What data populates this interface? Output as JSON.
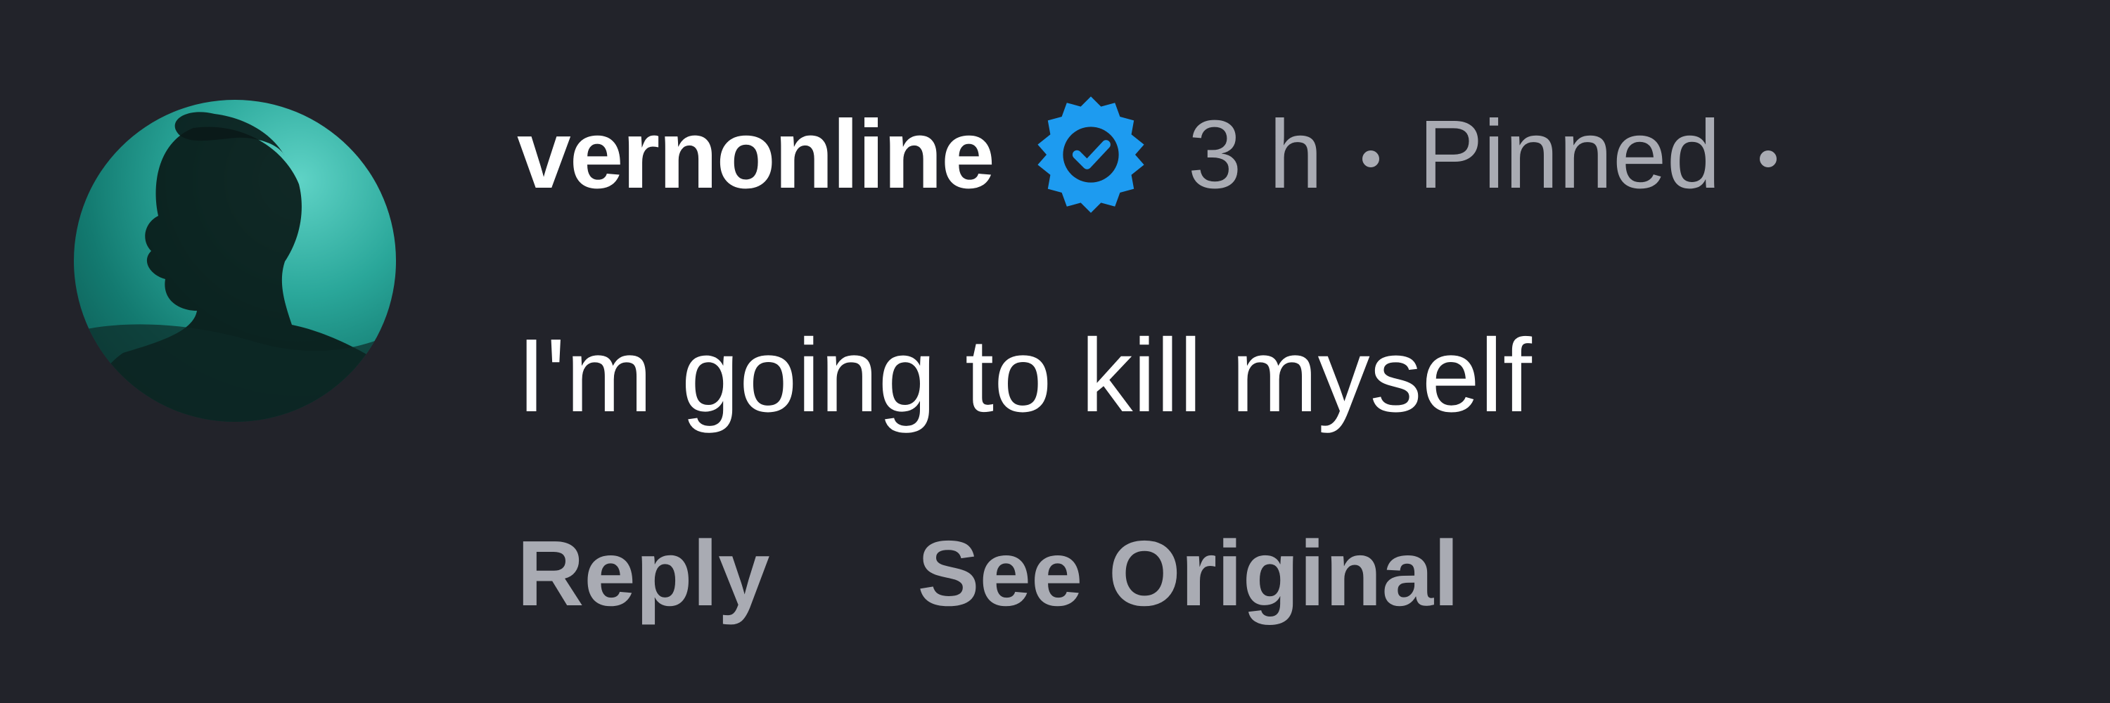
{
  "comment": {
    "username": "vernonline",
    "verified_icon": "verified-badge-icon",
    "timestamp": "3 h",
    "pinned_label": "Pinned",
    "text": "I'm going to kill myself",
    "actions": {
      "reply_label": "Reply",
      "see_original_label": "See Original"
    }
  },
  "colors": {
    "background": "#22232a",
    "username": "#ffffff",
    "meta": "#a9abb3",
    "verified": "#1d9bf0",
    "avatar_accent": "#2aa79a"
  }
}
